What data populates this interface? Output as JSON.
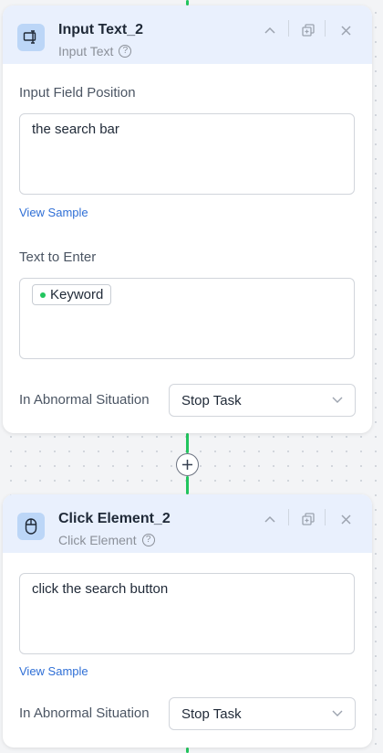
{
  "nodes": [
    {
      "title": "Input Text_2",
      "subtitle": "Input Text",
      "icon": "input-text-icon",
      "fields": {
        "position_label": "Input Field Position",
        "position_value": "the search bar",
        "view_sample": "View Sample",
        "text_label": "Text to Enter",
        "text_chip": "Keyword",
        "abnormal_label": "In Abnormal Situation",
        "abnormal_value": "Stop Task"
      }
    },
    {
      "title": "Click Element_2",
      "subtitle": "Click Element",
      "icon": "mouse-icon",
      "fields": {
        "element_value": "click the search button",
        "view_sample": "View Sample",
        "abnormal_label": "In Abnormal Situation",
        "abnormal_value": "Stop Task"
      }
    }
  ],
  "colors": {
    "accent": "#22c55e",
    "header_bg": "#e9f0fd",
    "link": "#2f6fd6"
  }
}
